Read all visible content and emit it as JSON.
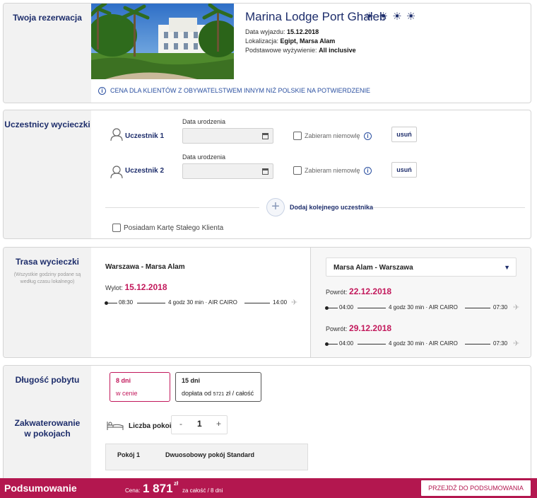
{
  "reservation": {
    "section_title": "Twoja rezerwacja",
    "hotel_name": "Marina Lodge Port Ghaleb",
    "stars": "☀ ☀ ☀ ☀",
    "departure_label": "Data wyjazdu:",
    "departure_value": "15.12.2018",
    "location_label": "Lokalizacja:",
    "location_value": "Egipt, Marsa Alam",
    "board_label": "Podstawowe wyżywienie:",
    "board_value": "All inclusive",
    "price_note": "CENA DLA KLIENTÓW Z OBYWATELSTWEM INNYM NIŻ POLSKIE NA POTWIERDZENIE"
  },
  "participants": {
    "section_title": "Uczestnicy wycieczki",
    "items": [
      {
        "name": "Uczestnik 1",
        "dob_label": "Data urodzenia",
        "infant_label": "Zabieram niemowlę",
        "remove_label": "usuń"
      },
      {
        "name": "Uczestnik 2",
        "dob_label": "Data urodzenia",
        "infant_label": "Zabieram niemowlę",
        "remove_label": "usuń"
      }
    ],
    "add_label": "Dodaj kolejnego uczestnika",
    "loyalty_label": "Posiadam Kartę Stałego Klienta"
  },
  "trip": {
    "section_title": "Trasa wycieczki",
    "section_note": "(Wszystkie godziny podane są według czasu lokalnego)",
    "outbound_route": "Warszawa - Marsa Alam",
    "outbound_label": "Wylot:",
    "outbound_date": "15.12.2018",
    "outbound_flight": {
      "dep": "08:30",
      "info": "4 godz 30 min · AIR CAIRO",
      "arr": "14:00"
    },
    "return_route": "Marsa Alam - Warszawa",
    "return_label": "Powrót:",
    "returns": [
      {
        "date": "22.12.2018",
        "dep": "04:00",
        "info": "4 godz 30 min · AIR CAIRO",
        "arr": "07:30"
      },
      {
        "date": "29.12.2018",
        "dep": "04:00",
        "info": "4 godz 30 min · AIR CAIRO",
        "arr": "07:30"
      }
    ]
  },
  "stay": {
    "section_title": "Długość pobytu",
    "options": [
      {
        "days": "8 dni",
        "price": "w cenie"
      },
      {
        "days": "15 dni",
        "price_prefix": "dopłata od",
        "price_value": "5721",
        "price_suffix": "zł / całość"
      }
    ],
    "rooms_title": "Zakwaterowanie w pokojach",
    "rooms_count_label": "Liczba pokoi",
    "rooms_count": "1",
    "room_label": "Pokój 1",
    "room_type": "Dwuosobowy pokój Standard"
  },
  "footer": {
    "title": "Podsumowanie",
    "price_label": "Cena:",
    "price": "1 871",
    "currency": "zł",
    "price_suffix": "za całość / 8 dni",
    "button_label": "PRZEJDŹ DO PODSUMOWANIA"
  },
  "colors": {
    "accent": "#b3174f",
    "navy": "#1d2d6b",
    "link": "#2a4fa0"
  }
}
